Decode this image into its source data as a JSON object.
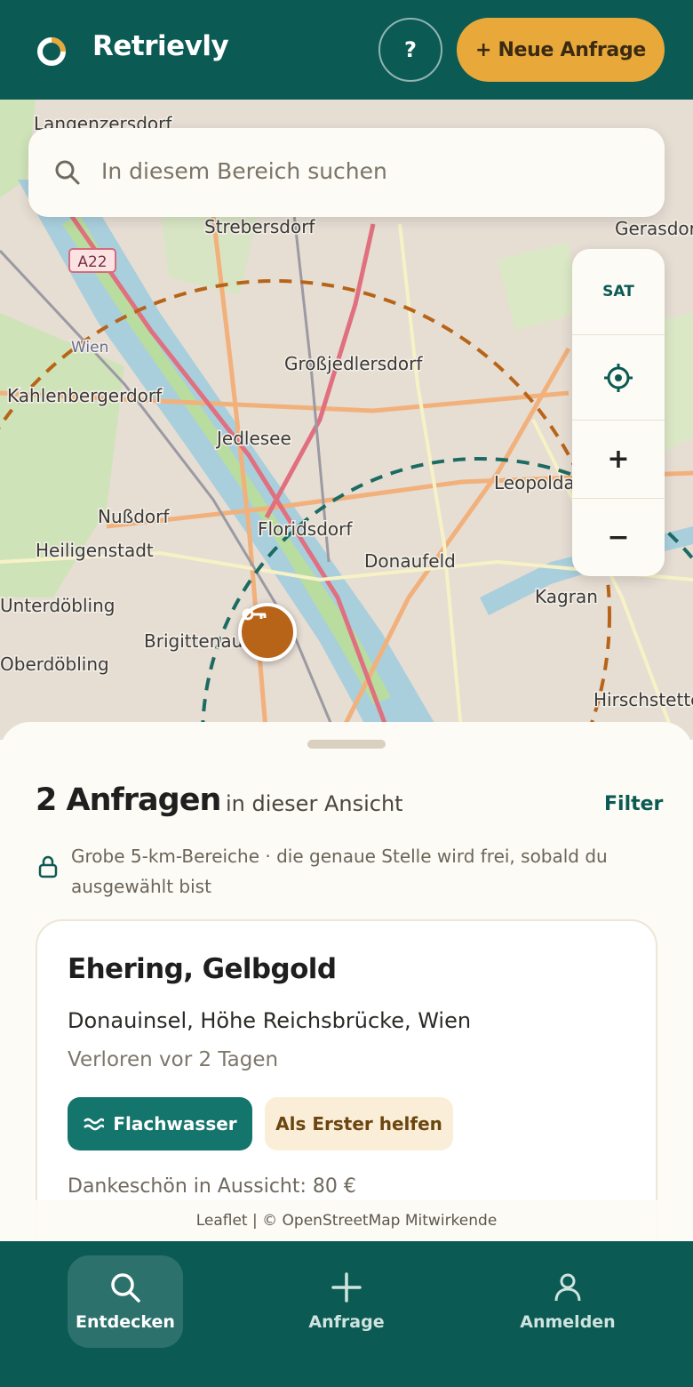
{
  "header": {
    "app_name": "Retrievly",
    "help_label": "?",
    "new_request_label": "+ Neue Anfrage"
  },
  "map": {
    "search_placeholder": "In diesem Bereich suchen",
    "controls": {
      "satellite_label": "SAT",
      "zoom_in_label": "+",
      "zoom_out_label": "−"
    },
    "place_labels": [
      "Langenzersdorf",
      "Strebersdorf",
      "Gerasdorf",
      "Wien",
      "Großjedlersdorf",
      "Kahlenbergerdorf",
      "Jedlesee",
      "Leopoldau",
      "Nußdorf",
      "Floridsdorf",
      "Heiligenstadt",
      "Donaufeld",
      "Unterdöbling",
      "Kagran",
      "Brigittenau",
      "Oberdöbling",
      "Hirschstetten",
      "A22"
    ],
    "area_colors": {
      "orange_circle": "#b86418",
      "green_circle": "#1c6b62"
    }
  },
  "sheet": {
    "count_title": "2 Anfragen",
    "count_subtitle": "in dieser Ansicht",
    "filter_label": "Filter",
    "privacy_note": "Grobe 5-km-Bereiche · die genaue Stelle wird frei, sobald du ausgewählt bist",
    "card": {
      "title": "Ehering, Gelbgold",
      "location": "Donauinsel, Höhe Reichsbrücke, Wien",
      "time": "Verloren vor 2 Tagen",
      "tag_water": "Flachwasser",
      "tag_first": "Als Erster helfen",
      "reward": "Dankeschön in Aussicht: 80 €"
    }
  },
  "attribution": "Leaflet | © OpenStreetMap Mitwirkende",
  "nav": {
    "discover": "Entdecken",
    "request": "Anfrage",
    "login": "Anmelden"
  }
}
